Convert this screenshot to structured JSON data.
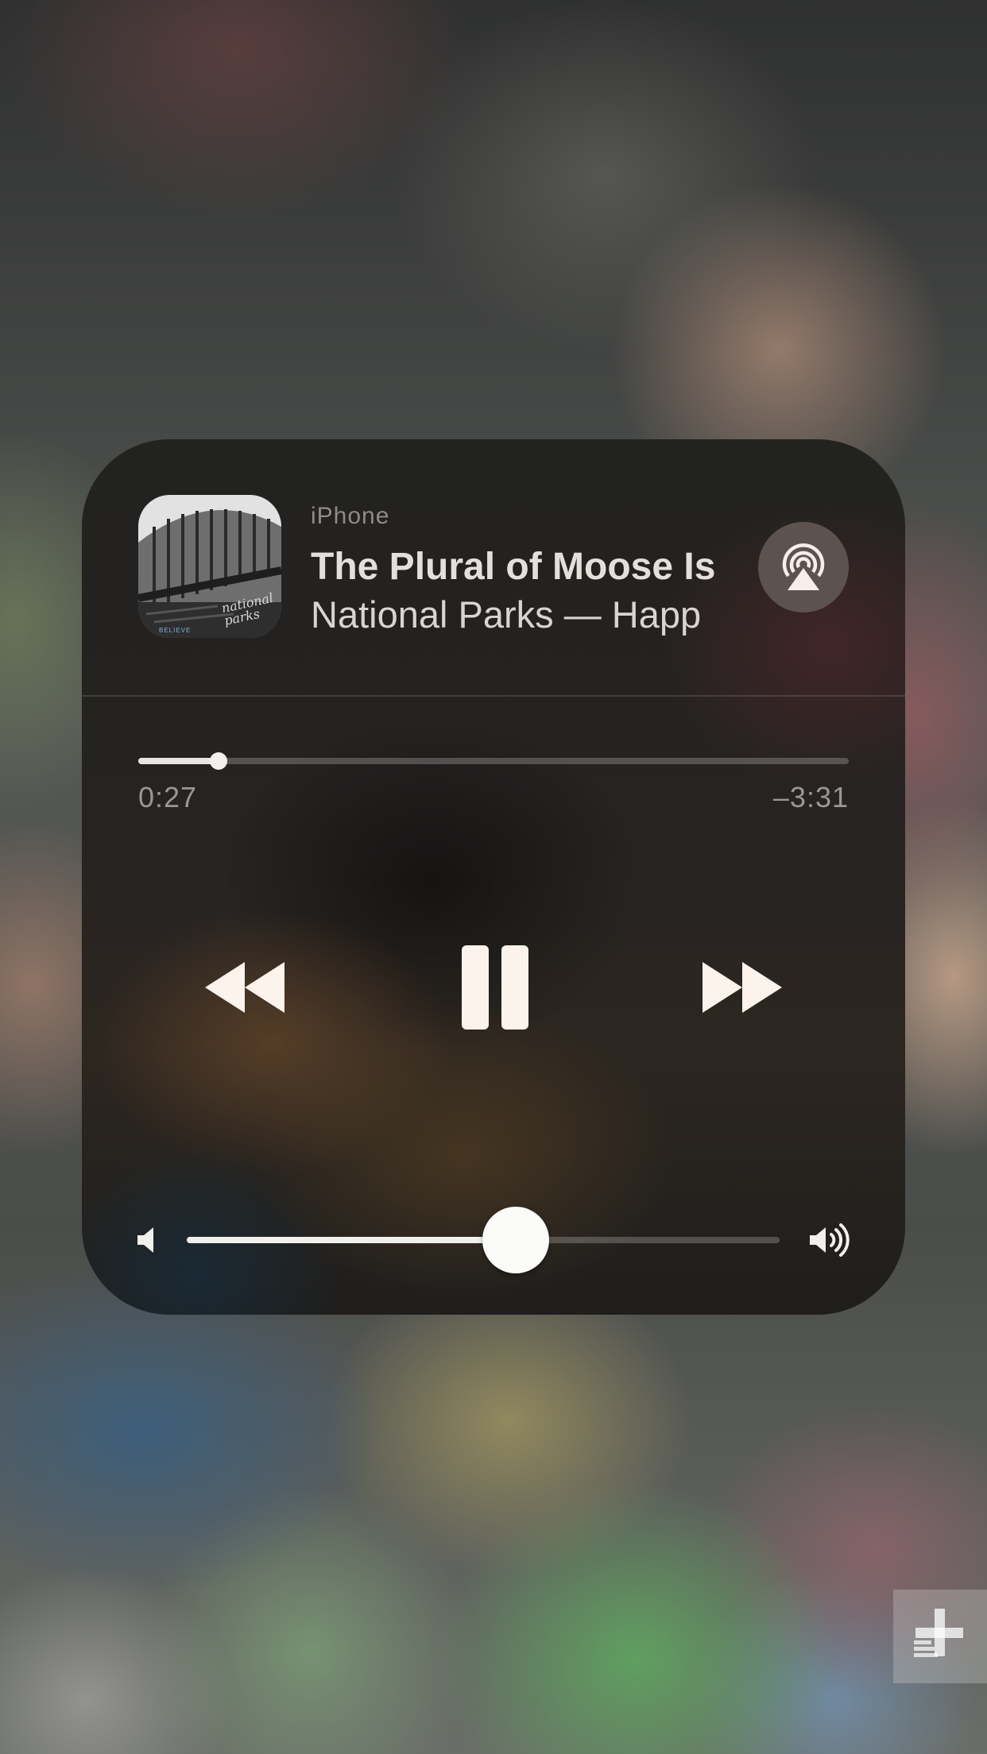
{
  "now_playing": {
    "device": "iPhone",
    "title": "The Plural of Moose Is",
    "artist_album": "National Parks — Happ",
    "artwork_text": "national parks",
    "artwork_badge": "BELIEVE"
  },
  "playback": {
    "elapsed": "0:27",
    "remaining": "–3:31",
    "progress_fraction": 0.113,
    "state": "playing"
  },
  "volume": {
    "level_fraction": 0.555
  },
  "icons": {
    "airplay": "airplay-icon",
    "rewind": "rewind-icon",
    "pause": "pause-icon",
    "forward": "fast-forward-icon",
    "volume_low": "speaker-low-icon",
    "volume_high": "speaker-high-icon",
    "watermark": "plus-watermark-icon"
  },
  "colors": {
    "card_background": "#23211f",
    "text_primary": "#e3e0dc",
    "text_secondary": "#9a9794",
    "controls": "#fbf3ec"
  }
}
